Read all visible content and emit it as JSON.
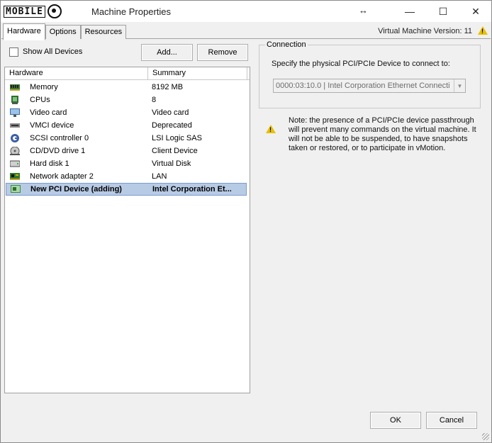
{
  "window": {
    "title": "Machine Properties",
    "logo_text": "MOBILE",
    "resize_glyph": "↔",
    "controls": {
      "minimize": "—",
      "maximize": "☐",
      "close": "✕"
    }
  },
  "tabs": [
    {
      "label": "Hardware",
      "active": true
    },
    {
      "label": "Options",
      "active": false
    },
    {
      "label": "Resources",
      "active": false
    }
  ],
  "vm_version": "Virtual Machine Version: 11",
  "hardware": {
    "show_all_devices_label": "Show All Devices",
    "show_all_devices_checked": false,
    "add_label": "Add...",
    "remove_label": "Remove",
    "columns": [
      "Hardware",
      "Summary"
    ],
    "devices": [
      {
        "name": "Memory",
        "summary": "8192 MB",
        "icon": "memory-icon"
      },
      {
        "name": "CPUs",
        "summary": "8",
        "icon": "cpu-icon"
      },
      {
        "name": "Video card",
        "summary": "Video card",
        "icon": "monitor-icon"
      },
      {
        "name": "VMCI device",
        "summary": "Deprecated",
        "icon": "vmci-icon"
      },
      {
        "name": "SCSI controller 0",
        "summary": "LSI Logic SAS",
        "icon": "scsi-icon"
      },
      {
        "name": "CD/DVD drive 1",
        "summary": "Client Device",
        "icon": "cd-drive-icon"
      },
      {
        "name": "Hard disk 1",
        "summary": "Virtual Disk",
        "icon": "hard-disk-icon"
      },
      {
        "name": "Network adapter 2",
        "summary": "LAN",
        "icon": "network-adapter-icon"
      },
      {
        "name": "New PCI Device (adding)",
        "summary": "Intel Corporation Et...",
        "icon": "pci-device-icon",
        "selected": true
      }
    ]
  },
  "connection": {
    "legend": "Connection",
    "label": "Specify the physical PCI/PCIe Device to connect to:",
    "selected_device": "0000:03:10.0 | Intel Corporation Ethernet Connecti"
  },
  "note": "Note: the presence of a PCI/PCIe device passthrough will prevent many commands on the virtual machine. It will not be able to be suspended, to have snapshots taken or restored, or to participate in vMotion.",
  "footer": {
    "ok_label": "OK",
    "cancel_label": "Cancel"
  },
  "colors": {
    "selection": "#b8cbe5",
    "warning": "#e8c000"
  }
}
